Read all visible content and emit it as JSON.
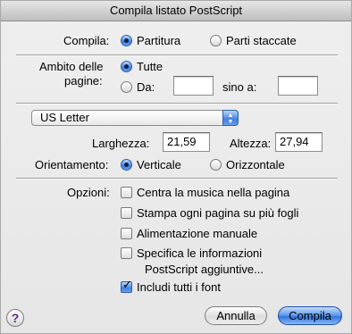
{
  "window": {
    "title": "Compila listato PostScript"
  },
  "compile": {
    "label": "Compila:",
    "options": [
      {
        "label": "Partitura",
        "selected": true
      },
      {
        "label": "Parti staccate",
        "selected": false
      }
    ]
  },
  "page_range": {
    "label_line1": "Ambito delle",
    "label_line2": "pagine:",
    "all_label": "Tutte",
    "all_selected": true,
    "from_label": "Da:",
    "from_value": "",
    "to_label": "sino a:",
    "to_value": ""
  },
  "paper": {
    "selected": "US Letter",
    "width_label": "Larghezza:",
    "width_value": "21,59",
    "height_label": "Altezza:",
    "height_value": "27,94"
  },
  "orientation": {
    "label": "Orientamento:",
    "options": [
      {
        "label": "Verticale",
        "selected": true
      },
      {
        "label": "Orizzontale",
        "selected": false
      }
    ]
  },
  "options": {
    "label": "Opzioni:",
    "center_music": {
      "label": "Centra la musica nella pagina",
      "checked": false
    },
    "print_multi": {
      "label": "Stampa ogni pagina su più fogli",
      "checked": false
    },
    "manual_feed": {
      "label": "Alimentazione manuale",
      "checked": false
    },
    "extra_info": {
      "label_line1": "Specifica le informazioni",
      "label_line2": "PostScript aggiuntive...",
      "checked": false
    },
    "include_fonts": {
      "label": "Includi tutti i font",
      "checked": true
    }
  },
  "buttons": {
    "cancel": "Annulla",
    "compile": "Compila",
    "help": "?"
  },
  "colors": {
    "accent": "#3f7fdd",
    "background": "#ececec"
  }
}
